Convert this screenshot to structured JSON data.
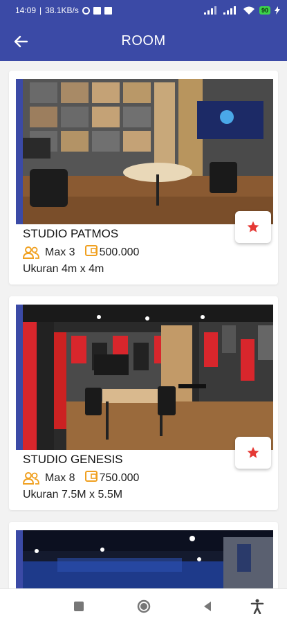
{
  "status_bar": {
    "time": "14:09",
    "network_speed": "38.1KB/s",
    "battery": "90"
  },
  "app_bar": {
    "title": "ROOM",
    "back_icon": "arrow-left-icon"
  },
  "rooms": [
    {
      "name": "STUDIO PATMOS",
      "capacity": "Max 3",
      "price": "500.000",
      "size": "Ukuran 4m x 4m",
      "favorite_icon": "star-icon"
    },
    {
      "name": "STUDIO GENESIS",
      "capacity": "Max 8",
      "price": "750.000",
      "size": "Ukuran 7.5M x 5.5M",
      "favorite_icon": "star-icon"
    }
  ],
  "colors": {
    "primary": "#3b4aa6",
    "accent_orange": "#f0a020",
    "star_red": "#e53935"
  },
  "nav_bar": {
    "buttons": [
      "square-icon",
      "circle-icon",
      "back-triangle-icon",
      "accessibility-icon"
    ]
  }
}
